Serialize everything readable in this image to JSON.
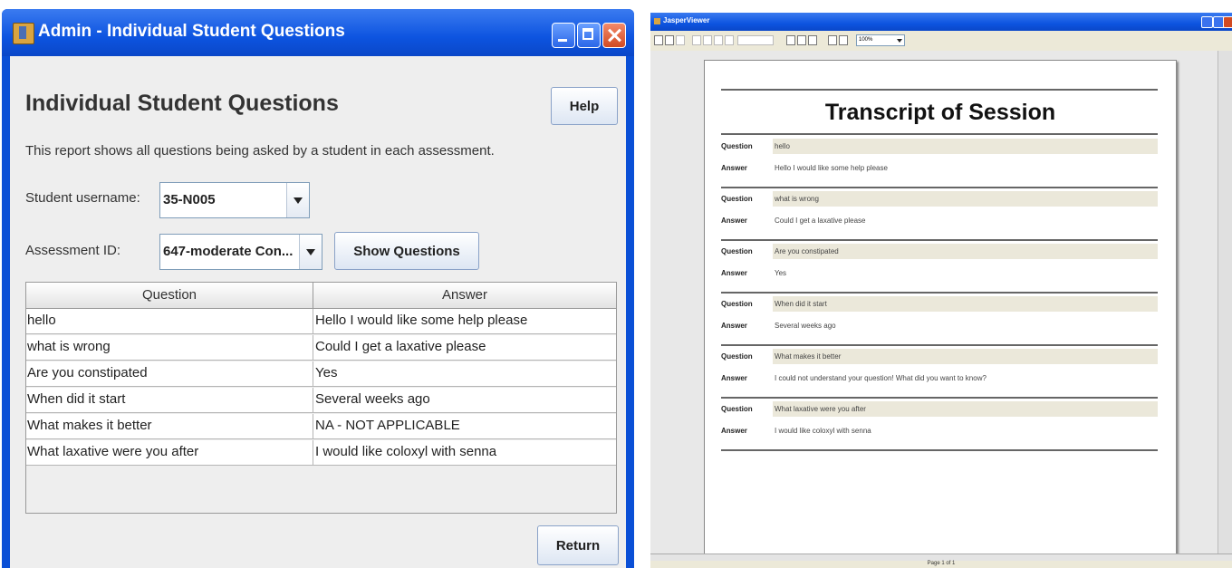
{
  "admin_window": {
    "title": "Admin - Individual Student Questions",
    "page_title": "Individual Student Questions",
    "help_label": "Help",
    "description": "This report shows all questions being asked by a student in each assessment.",
    "student_label": "Student username:",
    "student_value": "35-N005",
    "assessment_label": "Assessment ID:",
    "assessment_value": "647-moderate Con...",
    "show_label": "Show Questions",
    "return_label": "Return",
    "table": {
      "headers": [
        "Question",
        "Answer"
      ],
      "rows": [
        {
          "q": "hello",
          "a": "Hello I would like some help please"
        },
        {
          "q": "what is wrong",
          "a": "Could I get a laxative please"
        },
        {
          "q": "Are you constipated",
          "a": "Yes"
        },
        {
          "q": "When did it start",
          "a": "Several weeks ago"
        },
        {
          "q": "What makes it better",
          "a": "NA - NOT APPLICABLE"
        },
        {
          "q": "What laxative were you after",
          "a": "I would like coloxyl with senna"
        }
      ]
    }
  },
  "viewer_window": {
    "title": "JasperViewer",
    "zoom": "100%",
    "status": "Page 1 of 1",
    "doc_title": "Transcript of Session",
    "question_label": "Question",
    "answer_label": "Answer",
    "entries": [
      {
        "q": "hello",
        "a": "Hello I would like some help please"
      },
      {
        "q": "what is wrong",
        "a": "Could I get a laxative please"
      },
      {
        "q": "Are you constipated",
        "a": "Yes"
      },
      {
        "q": "When did it start",
        "a": "Several weeks ago"
      },
      {
        "q": "What makes it better",
        "a": "I could not understand your question! What did you want to know?"
      },
      {
        "q": "What laxative were you after",
        "a": "I would like coloxyl with senna"
      }
    ]
  }
}
